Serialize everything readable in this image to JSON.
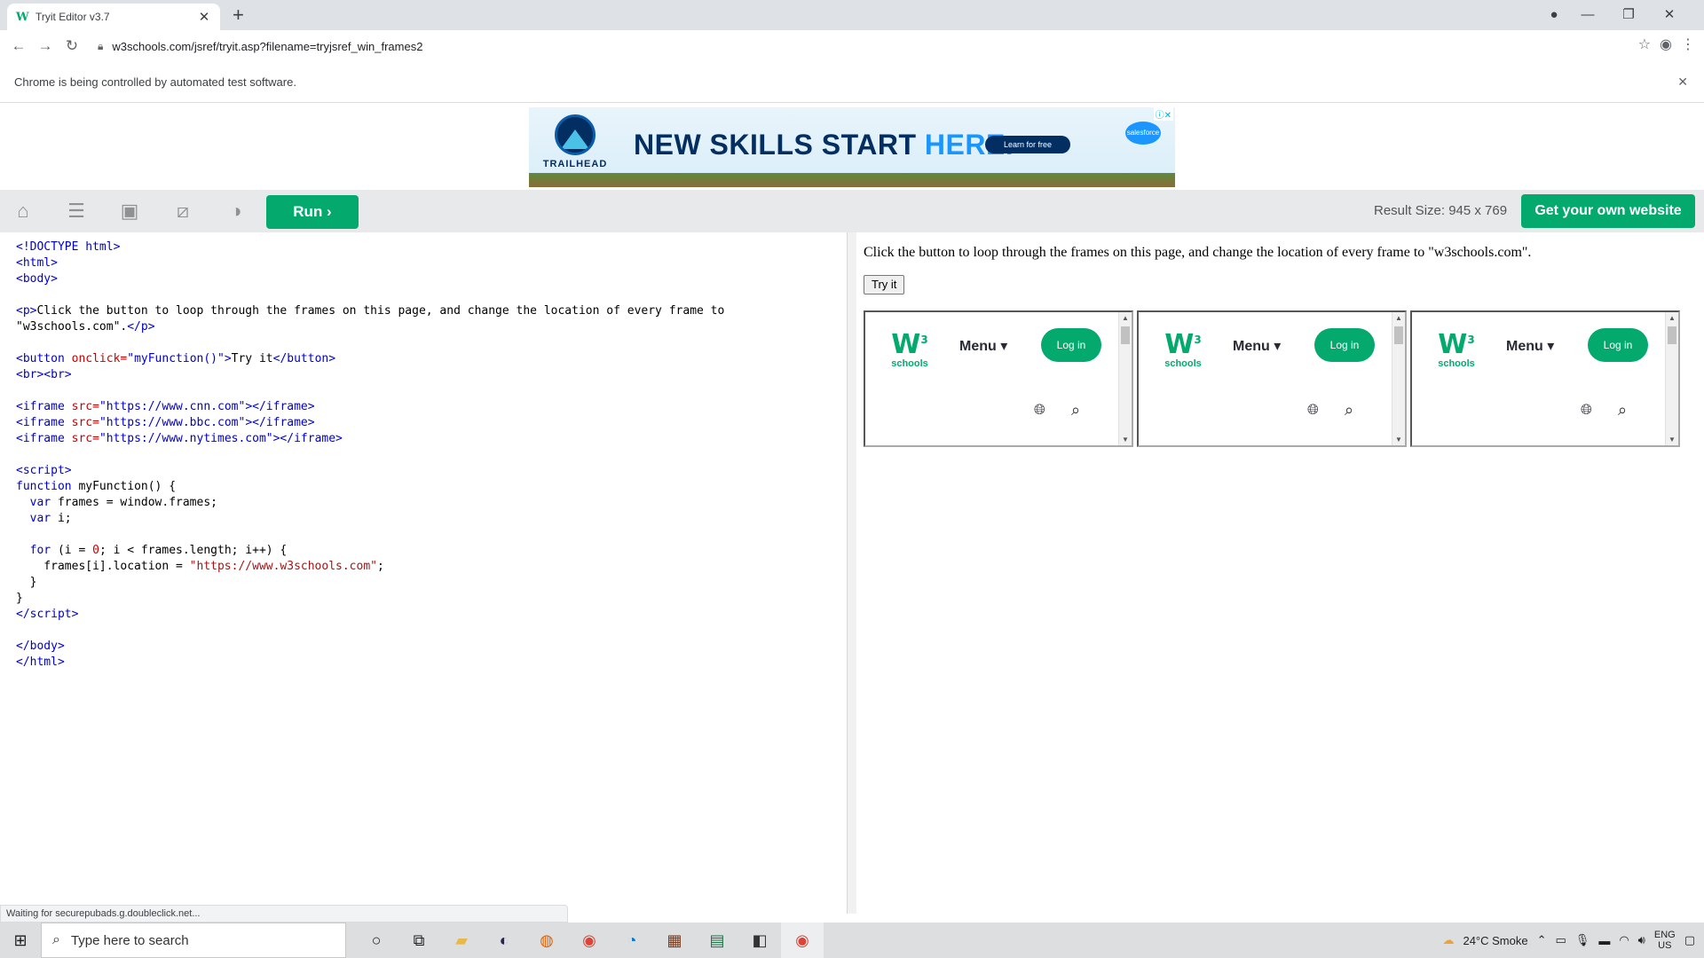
{
  "browser": {
    "tab_title": "Tryit Editor v3.7",
    "url": "w3schools.com/jsref/tryit.asp?filename=tryjsref_win_frames2",
    "infobar_text": "Chrome is being controlled by automated test software.",
    "status_text": "Waiting for securepubads.g.doubleclick.net..."
  },
  "ad": {
    "brand": "TRAILHEAD",
    "headline_a": "NEW SKILLS START ",
    "headline_b": "HERE.",
    "button": "Learn for free",
    "partner": "salesforce"
  },
  "editor": {
    "run_label": "Run",
    "result_size": "Result Size: 945 x 769",
    "own_site_label": "Get your own website"
  },
  "result": {
    "paragraph": "Click the button to loop through the frames on this page, and change the location of every frame to \"w3schools.com\".",
    "button": "Try it",
    "frames": [
      {
        "logo_mark": "W",
        "logo_sup": "3",
        "logo_word": "schools",
        "menu": "Menu",
        "login": "Log in"
      },
      {
        "logo_mark": "W",
        "logo_sup": "3",
        "logo_word": "schools",
        "menu": "Menu",
        "login": "Log in"
      },
      {
        "logo_mark": "W",
        "logo_sup": "3",
        "logo_word": "schools",
        "menu": "Menu",
        "login": "Log in"
      }
    ]
  },
  "taskbar": {
    "search_placeholder": "Type here to search",
    "weather": "24°C Smoke",
    "lang_top": "ENG",
    "lang_bottom": "US"
  },
  "icons": {
    "editor_toolbar": [
      "home-icon",
      "menu-icon",
      "save-icon",
      "rotate-icon",
      "contrast-icon"
    ]
  }
}
